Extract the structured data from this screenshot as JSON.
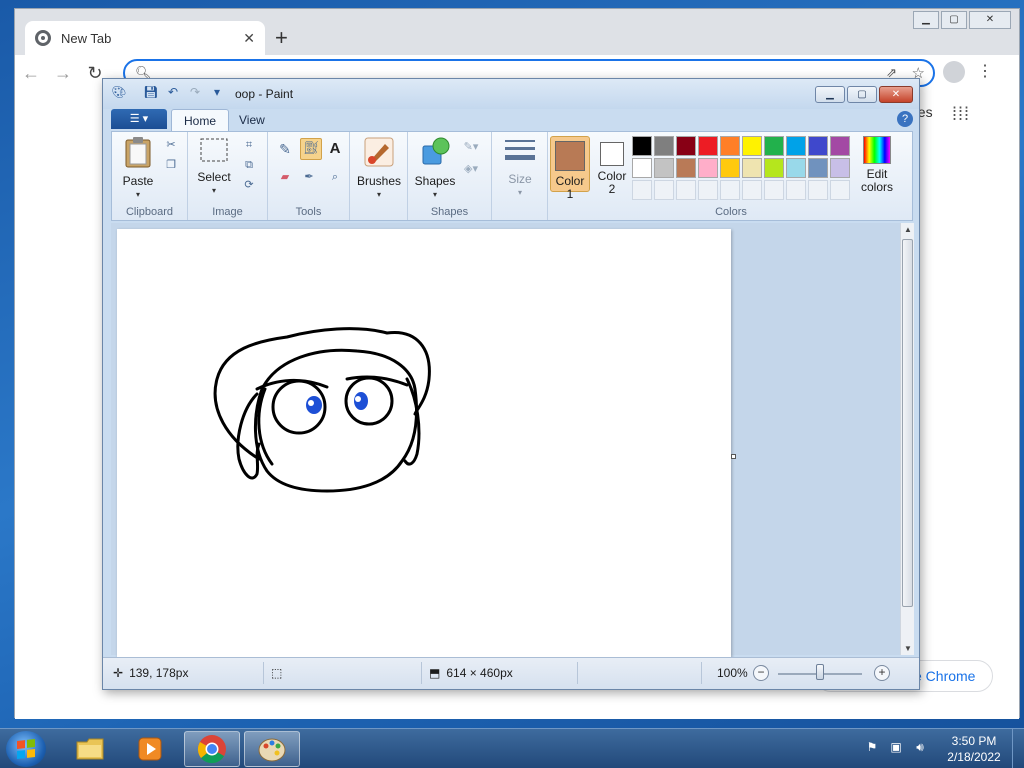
{
  "chrome": {
    "tab_title": "New Tab",
    "images_link": "ges",
    "customize_label": "e Chrome"
  },
  "paint": {
    "title": "oop - Paint",
    "tabs": [
      "Home",
      "View"
    ],
    "groups": {
      "clipboard": "Clipboard",
      "image": "Image",
      "tools": "Tools",
      "shapes": "Shapes",
      "colors": "Colors"
    },
    "buttons": {
      "paste": "Paste",
      "select": "Select",
      "brushes": "Brushes",
      "shapes": "Shapes",
      "size": "Size",
      "color1_line1": "Color",
      "color1_line2": "1",
      "color2_line1": "Color",
      "color2_line2": "2",
      "edit_colors_line1": "Edit",
      "edit_colors_line2": "colors"
    },
    "color1": "#b87a55",
    "color2": "#ffffff",
    "palette": [
      "#000000",
      "#7f7f7f",
      "#880015",
      "#ed1c24",
      "#ff7f27",
      "#fff200",
      "#22b14c",
      "#00a2e8",
      "#3f48cc",
      "#a349a4",
      "#ffffff",
      "#c3c3c3",
      "#b97a57",
      "#ffaec9",
      "#ffc90e",
      "#efe4b0",
      "#b5e61d",
      "#99d9ea",
      "#7092be",
      "#c8bfe7"
    ],
    "status": {
      "cursor_pos": "139, 178px",
      "canvas_size": "614 × 460px",
      "zoom": "100%"
    }
  },
  "taskbar": {
    "time": "3:50 PM",
    "date": "2/18/2022"
  }
}
